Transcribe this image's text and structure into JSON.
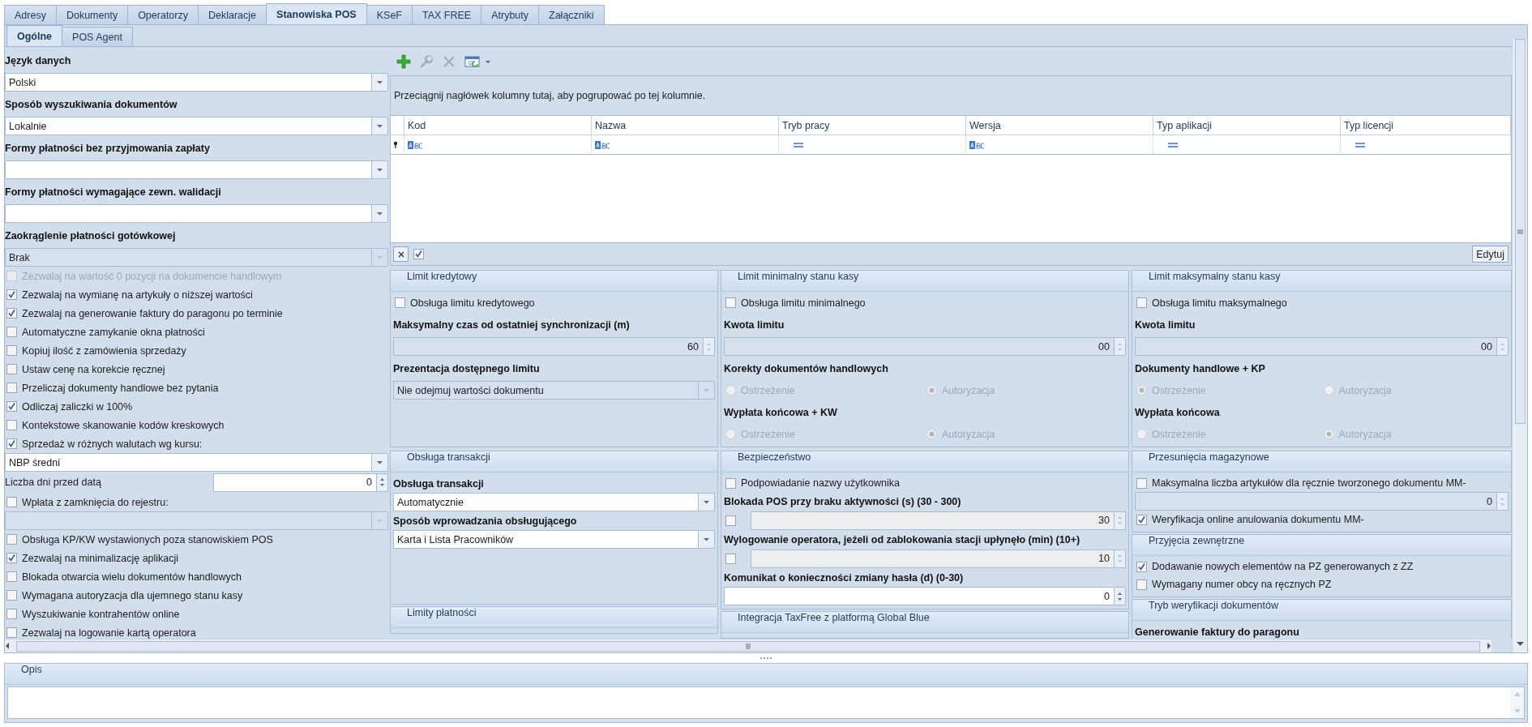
{
  "tabs": [
    {
      "label": "Adresy",
      "selected": false
    },
    {
      "label": "Dokumenty",
      "selected": false
    },
    {
      "label": "Operatorzy",
      "selected": false
    },
    {
      "label": "Deklaracje",
      "selected": false
    },
    {
      "label": "Stanowiska POS",
      "selected": true
    },
    {
      "label": "KSeF",
      "selected": false
    },
    {
      "label": "TAX FREE",
      "selected": false
    },
    {
      "label": "Atrybuty",
      "selected": false
    },
    {
      "label": "Załączniki",
      "selected": false
    }
  ],
  "subtabs": [
    {
      "label": "Ogólne",
      "selected": true
    },
    {
      "label": "POS Agent",
      "selected": false
    }
  ],
  "general": [
    {
      "kind": "label",
      "text": "Język danych"
    },
    {
      "kind": "combo",
      "value": "Polski",
      "disabled": false
    },
    {
      "kind": "label",
      "text": "Sposób wyszukiwania dokumentów"
    },
    {
      "kind": "combo",
      "value": "Lokalnie",
      "disabled": false
    },
    {
      "kind": "label",
      "text": "Formy płatności bez przyjmowania zapłaty"
    },
    {
      "kind": "combo",
      "disabled": false
    },
    {
      "kind": "label",
      "text": "Formy płatności wymagające zewn. walidacji"
    },
    {
      "kind": "combo",
      "disabled": false
    },
    {
      "kind": "label",
      "text": "Zaokrąglenie płatności gotówkowej"
    },
    {
      "kind": "combo",
      "value": "Brak",
      "disabled": true
    },
    {
      "kind": "check",
      "label": "Zezwalaj na wartość 0 pozycji na dokumencie handlowym",
      "checked": false,
      "disabled": true
    },
    {
      "kind": "check",
      "label": "Zezwalaj na wymianę na artykuły o niższej wartości",
      "checked": true,
      "disabled": false
    },
    {
      "kind": "check",
      "label": "Zezwalaj na generowanie faktury do paragonu po terminie",
      "checked": true,
      "disabled": false
    },
    {
      "kind": "check",
      "label": "Automatyczne zamykanie okna płatności",
      "checked": false,
      "disabled": false
    },
    {
      "kind": "check",
      "label": "Kopiuj ilość z zamówienia sprzedaży",
      "checked": false,
      "disabled": false
    },
    {
      "kind": "check",
      "label": "Ustaw cenę na korekcie ręcznej",
      "checked": false,
      "disabled": false
    },
    {
      "kind": "check",
      "label": "Przeliczaj dokumenty handlowe bez pytania",
      "checked": false,
      "disabled": false
    },
    {
      "kind": "check",
      "label": "Odliczaj zaliczki w 100%",
      "checked": true,
      "disabled": false
    },
    {
      "kind": "check",
      "label": "Kontekstowe skanowanie kodów kreskowych",
      "checked": false,
      "disabled": false
    },
    {
      "kind": "check",
      "label": "Sprzedaż w różnych walutach wg kursu:",
      "checked": true,
      "disabled": false
    },
    {
      "kind": "combo",
      "value": "NBP średni",
      "disabled": false
    },
    {
      "kind": "labeled_spin",
      "label": "Liczba dni przed datą",
      "value": "0",
      "disabled": false
    },
    {
      "kind": "check",
      "label": "Wpłata z zamknięcia do rejestru:",
      "checked": false,
      "disabled": false
    },
    {
      "kind": "combo",
      "disabled": true
    },
    {
      "kind": "check",
      "label": "Obsługa KP/KW wystawionych poza stanowiskiem POS",
      "checked": false,
      "disabled": false
    },
    {
      "kind": "check",
      "label": "Zezwalaj na minimalizację aplikacji",
      "checked": true,
      "disabled": false
    },
    {
      "kind": "check",
      "label": "Blokada otwarcia wielu dokumentów handlowych",
      "checked": false,
      "disabled": false
    },
    {
      "kind": "check",
      "label": "Wymagana autoryzacja dla ujemnego stanu kasy",
      "checked": false,
      "disabled": false
    },
    {
      "kind": "check",
      "label": "Wyszukiwanie kontrahentów online",
      "checked": false,
      "disabled": false
    },
    {
      "kind": "check",
      "label": "Zezwalaj na logowanie kartą operatora",
      "checked": false,
      "disabled": false
    }
  ],
  "toolbar": [
    {
      "kind": "add",
      "disabled": false
    },
    {
      "kind": "edit",
      "disabled": true
    },
    {
      "kind": "delete",
      "disabled": true
    },
    {
      "kind": "view",
      "disabled": false
    }
  ],
  "grid": {
    "group_hint": "Przeciągnij nagłówek kolumny tutaj, aby pogrupować po tej kolumnie.",
    "columns": [
      {
        "title": "Kod",
        "kind": "text"
      },
      {
        "title": "Nazwa",
        "kind": "text"
      },
      {
        "title": "Tryb pracy",
        "kind": "equals"
      },
      {
        "title": "Wersja",
        "kind": "text"
      },
      {
        "title": "Typ aplikacji",
        "kind": "equals"
      },
      {
        "title": "Typ licencji",
        "kind": "equals"
      }
    ],
    "filter_enabled": true,
    "edit_button": "Edytuj"
  },
  "panel_grid": {
    "top": [
      {
        "title": "Limit kredytowy",
        "items": [
          {
            "kind": "check",
            "label": "Obsługa limitu kredytowego",
            "checked": false,
            "disabled": false
          },
          {
            "kind": "label",
            "text": "Maksymalny czas od ostatniej synchronizacji (m)"
          },
          {
            "kind": "spin",
            "value": "60",
            "disabled": true
          },
          {
            "kind": "label",
            "text": "Prezentacja dostępnego limitu"
          },
          {
            "kind": "combo",
            "value": "Nie odejmuj wartości dokumentu",
            "disabled": true
          }
        ]
      },
      {
        "title": "Limit minimalny stanu kasy",
        "items": [
          {
            "kind": "check",
            "label": "Obsługa limitu minimalnego",
            "checked": false,
            "disabled": false
          },
          {
            "kind": "label",
            "text": "Kwota limitu"
          },
          {
            "kind": "spin",
            "value": "00",
            "disabled": true
          },
          {
            "kind": "label",
            "text": "Korekty dokumentów handlowych"
          },
          {
            "kind": "radios",
            "disabled": true,
            "options": [
              {
                "label": "Ostrzeżenie",
                "selected": false
              },
              {
                "label": "Autoryzacja",
                "selected": true
              }
            ]
          },
          {
            "kind": "label",
            "text": "Wypłata końcowa + KW"
          },
          {
            "kind": "radios",
            "disabled": true,
            "options": [
              {
                "label": "Ostrzeżenie",
                "selected": false
              },
              {
                "label": "Autoryzacja",
                "selected": true
              }
            ]
          }
        ]
      },
      {
        "title": "Limit maksymalny stanu kasy",
        "items": [
          {
            "kind": "check",
            "label": "Obsługa limitu maksymalnego",
            "checked": false,
            "disabled": false
          },
          {
            "kind": "label",
            "text": "Kwota limitu"
          },
          {
            "kind": "spin",
            "value": "00",
            "disabled": true
          },
          {
            "kind": "label",
            "text": "Dokumenty handlowe + KP"
          },
          {
            "kind": "radios",
            "disabled": true,
            "options": [
              {
                "label": "Ostrzeżenie",
                "selected": true
              },
              {
                "label": "Autoryzacja",
                "selected": false
              }
            ]
          },
          {
            "kind": "label",
            "text": "Wypłata końcowa"
          },
          {
            "kind": "radios",
            "disabled": true,
            "options": [
              {
                "label": "Ostrzeżenie",
                "selected": false
              },
              {
                "label": "Autoryzacja",
                "selected": true
              }
            ]
          }
        ]
      }
    ],
    "columns": [
      [
        {
          "title": "Obsługa transakcji",
          "items": [
            {
              "kind": "label",
              "text": "Obsługa transakcji"
            },
            {
              "kind": "combo",
              "value": "Automatycznie",
              "disabled": false
            },
            {
              "kind": "label",
              "text": "Sposób wprowadzania obsługującego"
            },
            {
              "kind": "combo",
              "value": "Karta i Lista Pracowników",
              "disabled": false
            }
          ]
        },
        {
          "title": "Limity płatności"
        }
      ],
      [
        {
          "title": "Bezpieczeństwo",
          "items": [
            {
              "kind": "check",
              "label": "Podpowiadanie nazwy użytkownika",
              "checked": false,
              "disabled": false
            },
            {
              "kind": "label",
              "text": "Blokada POS przy braku aktywności (s) (30 - 300)"
            },
            {
              "kind": "checkspin",
              "checked": false,
              "value": "30",
              "disabled": true
            },
            {
              "kind": "label",
              "text": "Wylogowanie operatora, jeżeli od zablokowania stacji upłynęło (min) (10+)"
            },
            {
              "kind": "checkspin",
              "checked": false,
              "value": "10",
              "disabled": true
            },
            {
              "kind": "label",
              "text": "Komunikat o konieczności zmiany hasła (d) (0-30)"
            },
            {
              "kind": "spin",
              "value": "0",
              "disabled": false
            }
          ]
        },
        {
          "title": "Integracja TaxFree z platformą Global Blue"
        }
      ],
      [
        {
          "title": "Przesunięcia magazynowe",
          "items": [
            {
              "kind": "check",
              "label": "Maksymalna liczba artykułów dla ręcznie tworzonego dokumentu MM-",
              "checked": false,
              "disabled": false
            },
            {
              "kind": "spin",
              "value": "0",
              "disabled": true
            },
            {
              "kind": "check",
              "label": "Weryfikacja online anulowania dokumentu MM-",
              "checked": true,
              "disabled": false
            }
          ]
        },
        {
          "title": "Przyjęcia zewnętrzne",
          "items": [
            {
              "kind": "check",
              "label": "Dodawanie nowych elementów na PZ generowanych z ZZ",
              "checked": true,
              "disabled": false
            },
            {
              "kind": "check",
              "label": "Wymagany numer obcy na ręcznych PZ",
              "checked": false,
              "disabled": false
            }
          ]
        },
        {
          "title": "Tryb weryfikacji dokumentów",
          "items": [
            {
              "kind": "label",
              "text": "Generowanie faktury do paragonu"
            }
          ]
        }
      ]
    ]
  },
  "description": {
    "title": "Opis"
  }
}
